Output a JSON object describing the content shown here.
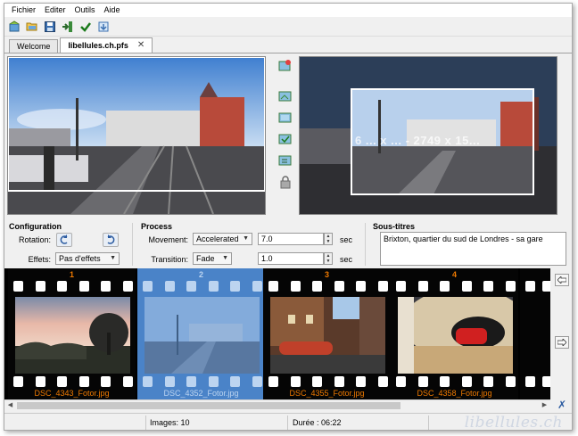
{
  "menu": {
    "items": [
      "Fichier",
      "Editer",
      "Outils",
      "Aide"
    ]
  },
  "toolbar": {
    "buttons": [
      "new-project-icon",
      "open-folder-icon",
      "save-icon",
      "import-icon",
      "checkmark-icon",
      "export-icon"
    ]
  },
  "tabs": [
    {
      "label": "Welcome",
      "active": false
    },
    {
      "label": "libellules.ch.pfs",
      "active": true
    }
  ],
  "preview": {
    "dimensions_overlay": "6 ... x ... - 2749 x 15..."
  },
  "configuration": {
    "title": "Configuration",
    "rotation_label": "Rotation:",
    "effects_label": "Effets:",
    "effects_value": "Pas d'effets"
  },
  "process": {
    "title": "Process",
    "movement_label": "Movement:",
    "movement_value": "Accelerated",
    "movement_duration": "7.0",
    "transition_label": "Transition:",
    "transition_value": "Fade",
    "transition_duration": "1.0",
    "unit": "sec"
  },
  "subtitles": {
    "title": "Sous-titres",
    "text": "Brixton, quartier du sud de Londres - sa gare"
  },
  "filmstrip": {
    "frames": [
      {
        "number": "1",
        "filename": "DSC_4343_Fotor.jpg",
        "selected": false
      },
      {
        "number": "2",
        "filename": "DSC_4352_Fotor.jpg",
        "selected": true
      },
      {
        "number": "3",
        "filename": "DSC_4355_Fotor.jpg",
        "selected": false
      },
      {
        "number": "4",
        "filename": "DSC_4358_Fotor.jpg",
        "selected": false
      }
    ]
  },
  "status": {
    "images": "Images: 10",
    "duration": "Durée : 06:22",
    "watermark": "libellules.ch"
  },
  "colors": {
    "accent_orange": "#f07a00",
    "selection_blue": "#4a83c8"
  }
}
